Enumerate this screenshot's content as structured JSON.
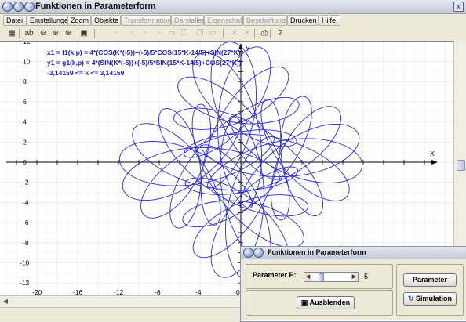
{
  "window": {
    "title": "Funktionen in Parameterform",
    "close_glyph": "x"
  },
  "menu": [
    {
      "label": "Datei",
      "enabled": true
    },
    {
      "label": "Einstellungen",
      "enabled": true
    },
    {
      "label": "Zoom",
      "enabled": true
    },
    {
      "label": "Objekte",
      "enabled": true
    },
    {
      "label": "Transformation",
      "enabled": false
    },
    {
      "label": "Darstellen",
      "enabled": false
    },
    {
      "label": "Eigenschaft",
      "enabled": false
    },
    {
      "label": "Beschriftung",
      "enabled": false
    },
    {
      "label": "Drucken",
      "enabled": true
    },
    {
      "label": "Hilfe",
      "enabled": true
    }
  ],
  "toolbar": {
    "icons": [
      {
        "name": "calculator-icon",
        "glyph": "▦"
      },
      {
        "name": "text-abc-icon",
        "glyph": "ab"
      },
      {
        "name": "zoom-out-icon",
        "glyph": "⊖"
      },
      {
        "name": "zoom-in-icon",
        "glyph": "⊕"
      },
      {
        "name": "zoom-fit-icon",
        "glyph": "⊕"
      },
      {
        "name": "table-icon",
        "glyph": "▣"
      },
      {
        "name": "grid-small-icon",
        "glyph": "▫"
      },
      {
        "name": "grid-icon",
        "glyph": "▫"
      },
      {
        "name": "grid-large-icon",
        "glyph": "▫"
      },
      {
        "name": "grid-dotted-icon",
        "glyph": "▫"
      },
      {
        "name": "window-icon",
        "glyph": "▭"
      },
      {
        "name": "copy-icon",
        "glyph": "❐"
      },
      {
        "name": "paste-icon",
        "glyph": "❐"
      },
      {
        "name": "export-icon",
        "glyph": "▭"
      },
      {
        "name": "delete-icon",
        "glyph": "✕"
      },
      {
        "name": "delete-all-icon",
        "glyph": "✕"
      },
      {
        "name": "print-icon",
        "glyph": "⎙"
      },
      {
        "name": "help-icon",
        "glyph": "?"
      }
    ]
  },
  "plot": {
    "formula_x": "x1 = f1(k,p) = 4*(COS(K*(-5))+(-5)/5*COS(15*K-14/5)+SIN(27*K))",
    "formula_y": "y1 = g1(k,p) = 4*(SIN(K*(-5))+(-5)/5*SIN(15*K-14/5)+COS(27*K))",
    "domain": "-3,14159 <= k <= 3,14159",
    "x_axis_label": "X",
    "y_axis_label": "Y",
    "x_ticks": [
      "-20",
      "-16",
      "-12",
      "-8",
      "-4",
      "0"
    ],
    "y_ticks": [
      "12",
      "10",
      "8",
      "6",
      "4",
      "2",
      "0",
      "-2",
      "-4",
      "-6",
      "-8",
      "-10",
      "-12"
    ],
    "curve_color": "#2a2ad6",
    "axis_color": "#000000"
  },
  "panel": {
    "title": "Funktionen in Parameterform",
    "parameter_label": "Parameter P:",
    "parameter_value": "-5",
    "parameter_level": 0.2,
    "hide_button": "Ausblenden",
    "parameter_button": "Parameter",
    "simulation_button": "Simulation"
  }
}
